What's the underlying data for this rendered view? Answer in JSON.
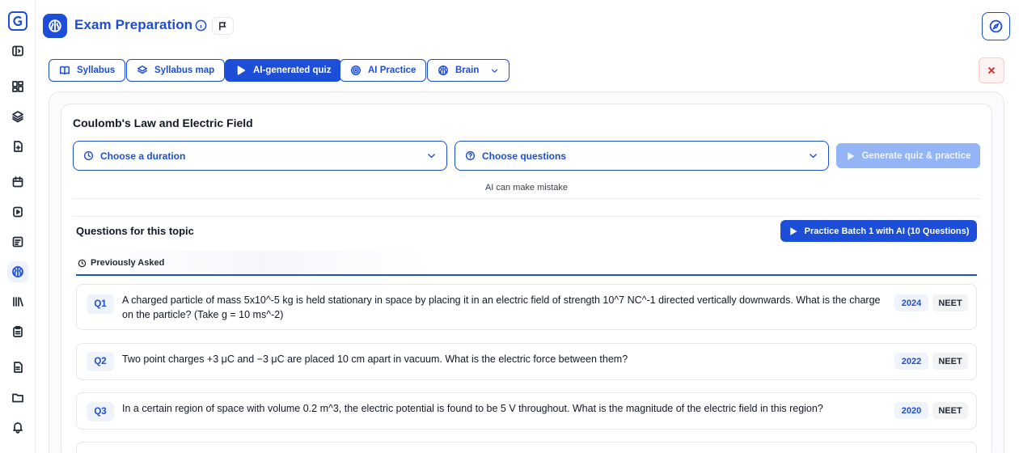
{
  "header": {
    "title": "Exam Preparation"
  },
  "tabs": [
    {
      "label": "Syllabus",
      "icon": "book-open-icon",
      "active": false
    },
    {
      "label": "Syllabus map",
      "icon": "layers-icon",
      "active": false
    },
    {
      "label": "AI-generated quiz",
      "icon": "play-icon",
      "active": true
    },
    {
      "label": "AI Practice",
      "icon": "target-icon",
      "active": false
    },
    {
      "label": "Brain",
      "icon": "brain-icon",
      "active": false
    }
  ],
  "topic": {
    "title": "Coulomb's Law and Electric Field",
    "duration_placeholder": "Choose a duration",
    "questions_placeholder": "Choose questions",
    "generate_label": "Generate quiz & practice",
    "disclaimer": "AI can make mistake"
  },
  "questions_section": {
    "title": "Questions for this topic",
    "practice_label": "Practice Batch 1 with AI (10 Questions)",
    "subtab_label": "Previously Asked",
    "items": [
      {
        "num": "Q1",
        "text": "A charged particle of mass 5x10^-5 kg is held stationary in space by placing it in an electric field of strength 10^7 NC^-1 directed vertically downwards. What is the charge on the particle? (Take g = 10 ms^-2)",
        "year": "2024",
        "exam": "NEET"
      },
      {
        "num": "Q2",
        "text": "Two point charges +3 μC and −3 μC are placed 10 cm apart in vacuum. What is the electric force between them?",
        "year": "2022",
        "exam": "NEET"
      },
      {
        "num": "Q3",
        "text": "In a certain region of space with volume 0.2 m^3, the electric potential is found to be 5 V throughout. What is the magnitude of the electric field in this region?",
        "year": "2020",
        "exam": "NEET"
      }
    ]
  },
  "colors": {
    "accent": "#1d4ed8",
    "disabled_button": "#93b4f5",
    "danger": "#dc2626"
  }
}
